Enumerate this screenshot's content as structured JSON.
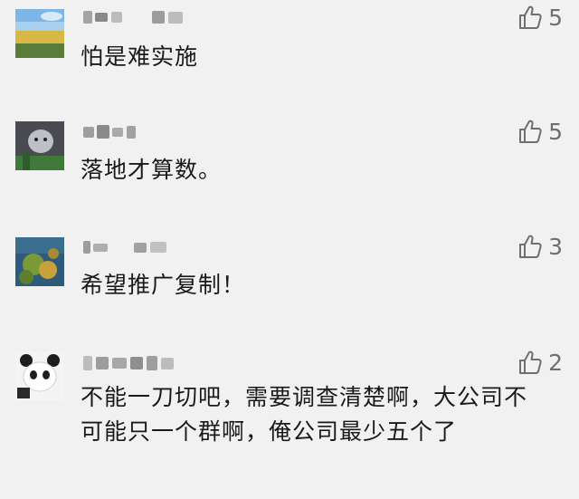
{
  "colors": {
    "background": "#f1f1f1",
    "text": "#1a1a1a",
    "muted": "#6f6f6f"
  },
  "comments": [
    {
      "avatar": "landscape-avatar",
      "username": "blurred",
      "likes": "5",
      "text": "怕是难实施"
    },
    {
      "avatar": "cat-avatar",
      "username": "blurred",
      "likes": "5",
      "text": "落地才算数。"
    },
    {
      "avatar": "garden-avatar",
      "username": "blurred",
      "likes": "3",
      "text": "希望推广复制！"
    },
    {
      "avatar": "panda-avatar",
      "username": "blurred",
      "likes": "2",
      "text": "不能一刀切吧，需要调查清楚啊，大公司不可能只一个群啊，俺公司最少五个了"
    }
  ]
}
